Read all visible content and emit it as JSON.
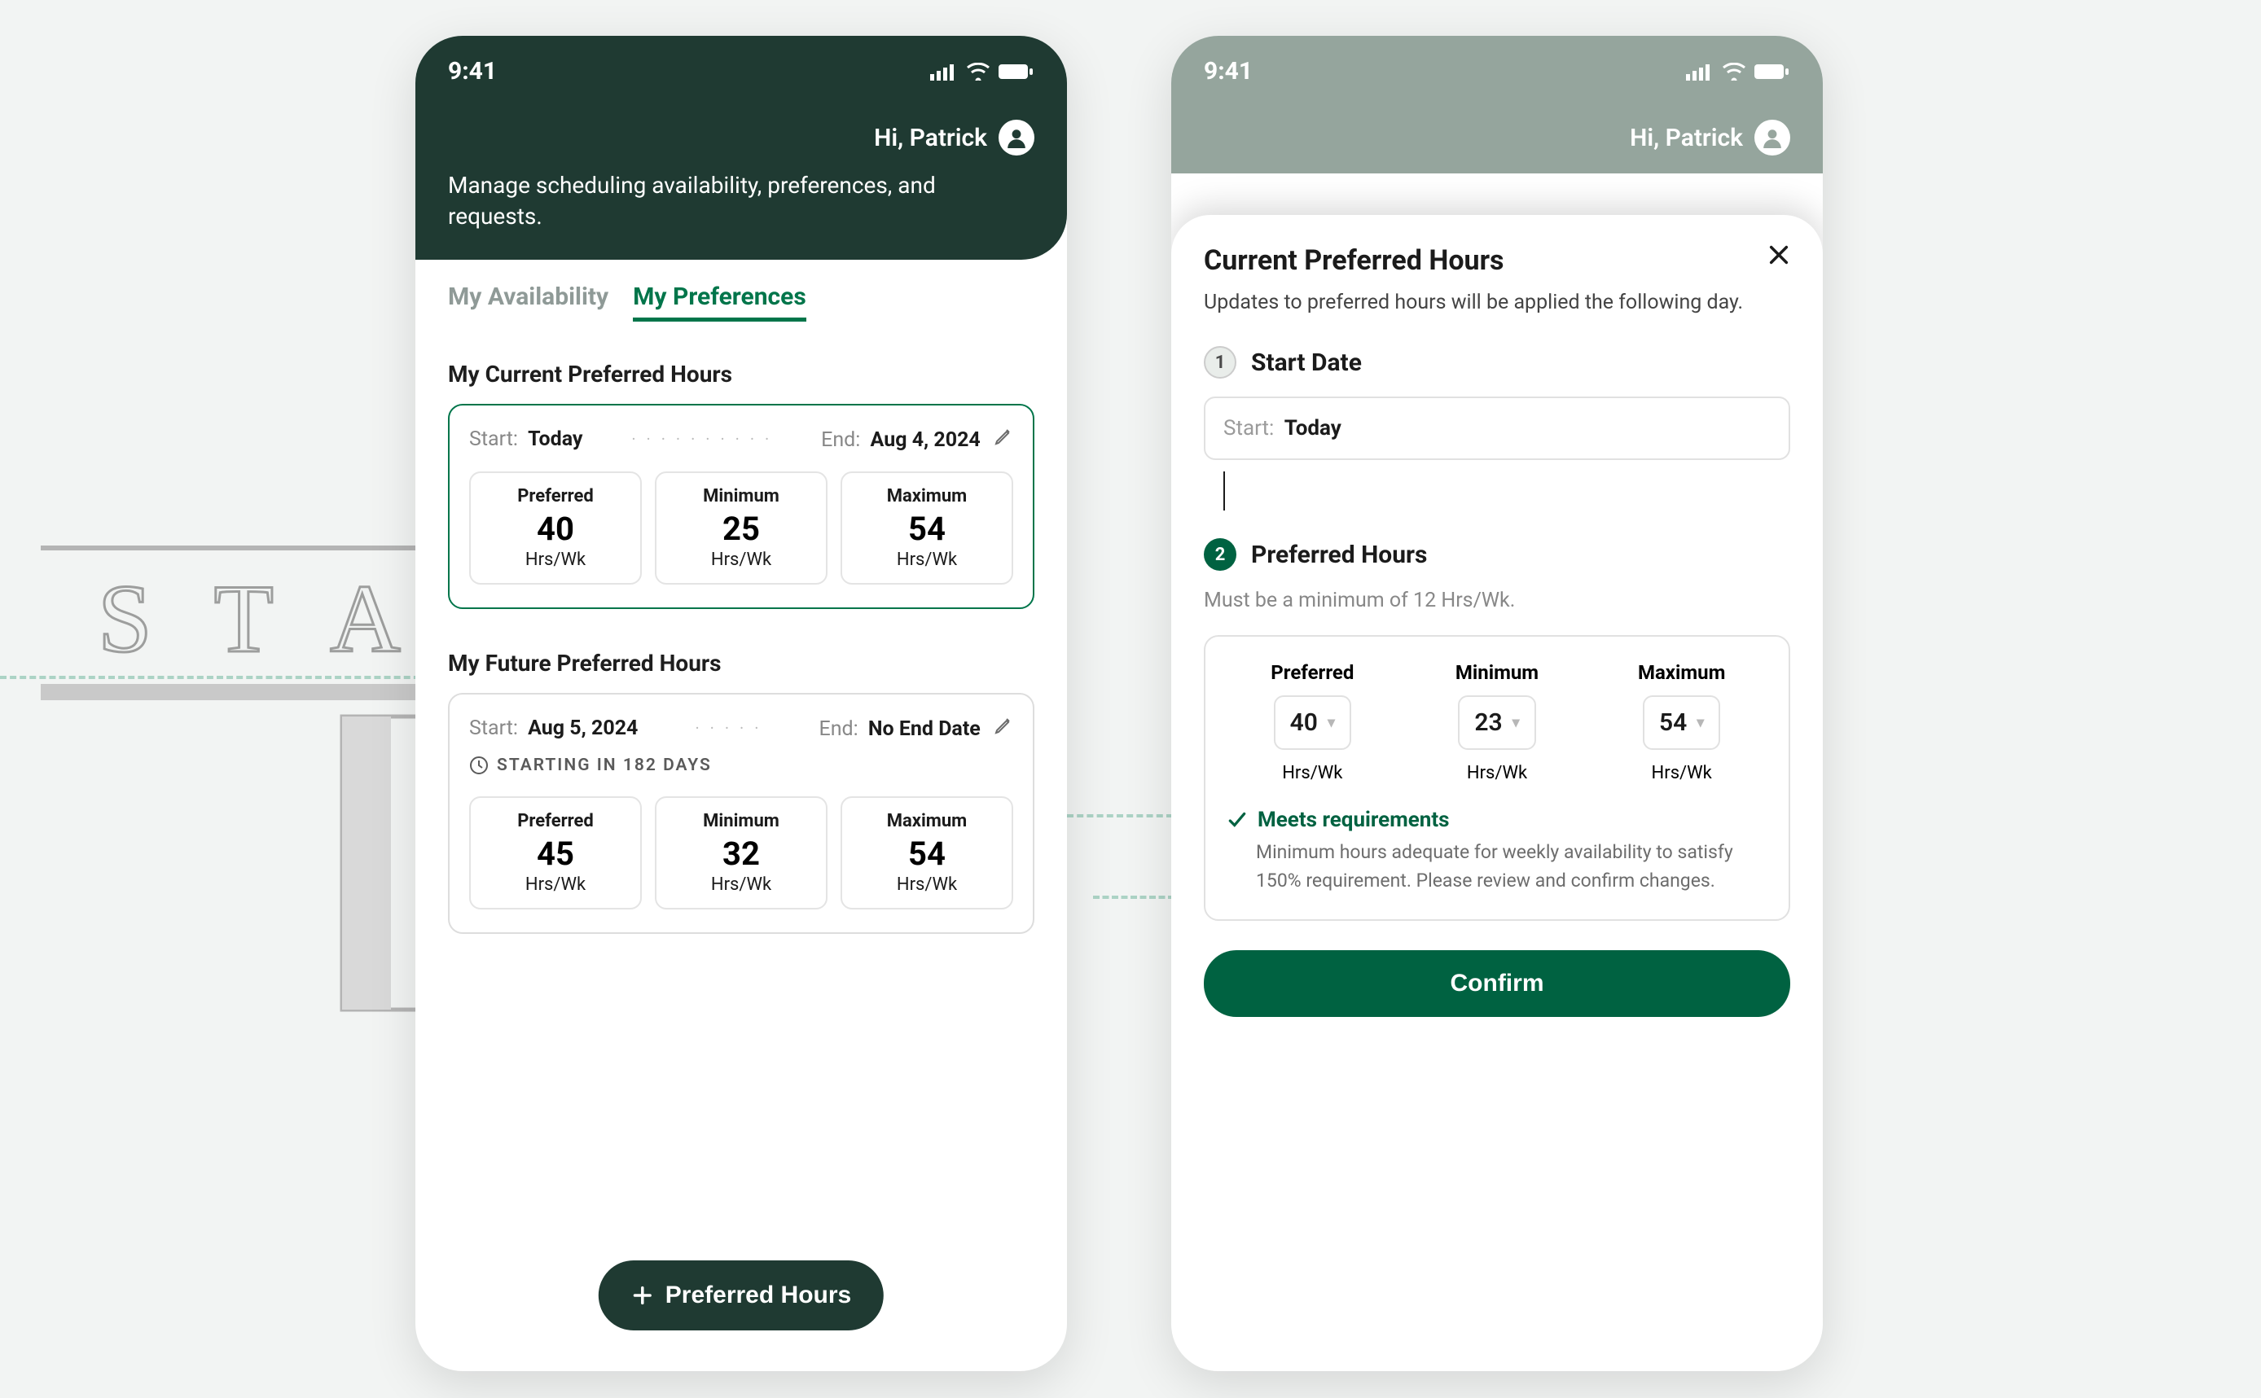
{
  "status": {
    "time": "9:41"
  },
  "header": {
    "greeting": "Hi,  Patrick",
    "subtitle": "Manage scheduling availability, preferences, and requests."
  },
  "tabs": {
    "availability": "My Availability",
    "preferences": "My Preferences"
  },
  "current": {
    "title": "My Current Preferred Hours",
    "startLabel": "Start:",
    "startValue": "Today",
    "endLabel": "End:",
    "endValue": "Aug 4, 2024",
    "labels": {
      "preferred": "Preferred",
      "minimum": "Minimum",
      "maximum": "Maximum",
      "unit": "Hrs/Wk"
    },
    "values": {
      "preferred": "40",
      "minimum": "25",
      "maximum": "54"
    }
  },
  "future": {
    "title": "My Future Preferred Hours",
    "startLabel": "Start:",
    "startValue": "Aug 5, 2024",
    "endLabel": "End:",
    "endValue": "No End Date",
    "startingNote": "STARTING IN 182 DAYS",
    "values": {
      "preferred": "45",
      "minimum": "32",
      "maximum": "54"
    }
  },
  "fab": {
    "label": "Preferred Hours"
  },
  "sheet": {
    "title": "Current Preferred Hours",
    "note": "Updates to preferred hours will be applied the following day.",
    "step1": {
      "num": "1",
      "label": "Start Date",
      "fieldLabel": "Start:",
      "fieldValue": "Today"
    },
    "step2": {
      "num": "2",
      "label": "Preferred Hours",
      "rule": "Must be a minimum of 12 Hrs/Wk."
    },
    "editor": {
      "preferred": "40",
      "minimum": "23",
      "maximum": "54"
    },
    "meets": {
      "heading": "Meets requirements",
      "body": "Minimum hours adequate for weekly availability to satisfy 150% requirement. Please review and confirm changes."
    },
    "confirm": "Confirm"
  }
}
